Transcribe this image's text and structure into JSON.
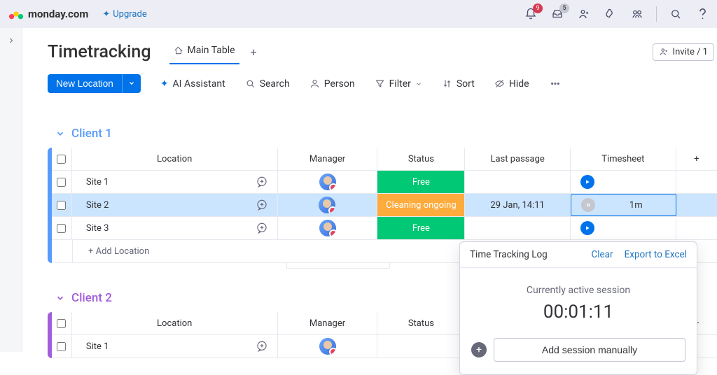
{
  "header": {
    "logo_text": "monday.com",
    "upgrade_label": "Upgrade",
    "notifications_badge": "9",
    "inbox_badge": "5"
  },
  "board": {
    "title": "Timetracking",
    "tabs": [
      {
        "label": "Main Table"
      }
    ],
    "add_tab": "+",
    "invite_label": "Invite / 1"
  },
  "toolbar": {
    "new_item": "New Location",
    "ai": "AI Assistant",
    "search": "Search",
    "person": "Person",
    "filter": "Filter",
    "sort": "Sort",
    "hide": "Hide"
  },
  "columns": {
    "location": "Location",
    "manager": "Manager",
    "status": "Status",
    "last": "Last passage",
    "timesheet": "Timesheet"
  },
  "groups": [
    {
      "name": "Client 1",
      "color_class": "c-blue",
      "table_color": "blue",
      "rows": [
        {
          "name": "Site 1",
          "status_label": "Free",
          "status_class": "st-free",
          "last": "",
          "ts_value": "",
          "ts_icon": "play",
          "selected": false
        },
        {
          "name": "Site 2",
          "status_label": "Cleaning ongoing",
          "status_class": "st-cleaning",
          "last": "29 Jan, 14:11",
          "ts_value": "1m",
          "ts_icon": "pause",
          "selected": true
        },
        {
          "name": "Site 3",
          "status_label": "Free",
          "status_class": "st-free",
          "last": "",
          "ts_value": "",
          "ts_icon": "play",
          "selected": false
        }
      ],
      "add_label": "+ Add Location"
    },
    {
      "name": "Client 2",
      "color_class": "c-purple",
      "table_color": "purple",
      "rows": [
        {
          "name": "Site 1",
          "status_label": "",
          "status_class": "",
          "last": "",
          "ts_value": "",
          "ts_icon": "",
          "selected": false
        }
      ],
      "add_label": ""
    }
  ],
  "popover": {
    "title": "Time Tracking Log",
    "clear": "Clear",
    "export": "Export to Excel",
    "session_label": "Currently active session",
    "timer": "00:01:11",
    "add_session": "Add session manually"
  }
}
